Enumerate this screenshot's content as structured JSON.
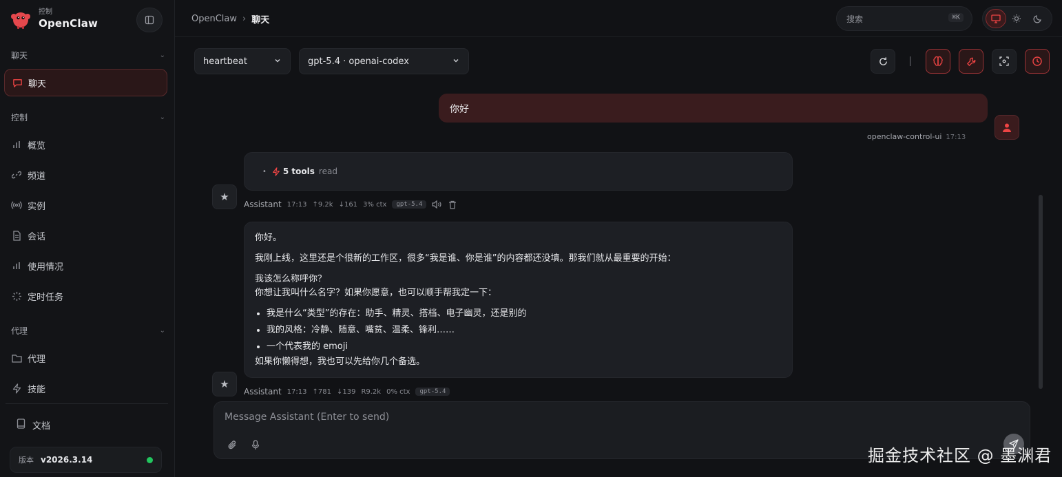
{
  "brand": {
    "subtitle": "控制",
    "name": "OpenClaw"
  },
  "sidebar": {
    "sections": [
      {
        "label": "聊天",
        "items": [
          {
            "label": "聊天",
            "icon": "message-icon",
            "active": true
          }
        ]
      },
      {
        "label": "控制",
        "items": [
          {
            "label": "概览",
            "icon": "bar-chart-icon"
          },
          {
            "label": "频道",
            "icon": "link-icon"
          },
          {
            "label": "实例",
            "icon": "broadcast-icon"
          },
          {
            "label": "会话",
            "icon": "file-icon"
          },
          {
            "label": "使用情况",
            "icon": "bar-chart-icon"
          },
          {
            "label": "定时任务",
            "icon": "loader-icon"
          }
        ]
      },
      {
        "label": "代理",
        "items": [
          {
            "label": "代理",
            "icon": "folder-icon"
          },
          {
            "label": "技能",
            "icon": "zap-icon"
          }
        ]
      }
    ],
    "docs_label": "文档",
    "version_label": "版本",
    "version_value": "v2026.3.14",
    "status_color": "#22c55e"
  },
  "header": {
    "breadcrumb": [
      "OpenClaw",
      "聊天"
    ],
    "search_placeholder": "搜索",
    "search_shortcut": "⌘K"
  },
  "chat": {
    "session_select": "heartbeat",
    "model_select": "gpt-5.4 · openai-codex",
    "messages": [
      {
        "role": "user",
        "text": "你好",
        "sender": "openclaw-control-ui",
        "time": "17:13"
      },
      {
        "role": "assistant",
        "tools_count": "5 tools",
        "tools_desc": "read",
        "meta": {
          "who": "Assistant",
          "time": "17:13",
          "up": "↑9.2k",
          "down": "↓161",
          "ctx": "3% ctx",
          "model": "gpt-5.4"
        }
      },
      {
        "role": "assistant",
        "paragraphs": [
          "你好。",
          "我刚上线，这里还是个很新的工作区，很多“我是谁、你是谁”的内容都还没填。那我们就从最重要的开始：",
          "我该怎么称呼你？",
          "你想让我叫什么名字？如果你愿意，也可以顺手帮我定一下："
        ],
        "bullets": [
          "我是什么“类型”的存在：助手、精灵、搭档、电子幽灵，还是别的",
          "我的风格：冷静、随意、嘴贫、温柔、锋利……",
          "一个代表我的 emoji"
        ],
        "closing": "如果你懒得想，我也可以先给你几个备选。",
        "meta": {
          "who": "Assistant",
          "time": "17:13",
          "up": "↑781",
          "down": "↓139",
          "cache": "R9.2k",
          "ctx": "0% ctx",
          "model": "gpt-5.4"
        }
      }
    ],
    "composer_placeholder": "Message Assistant (Enter to send)"
  },
  "watermark": "掘金技术社区 @ 墨渊君",
  "colors": {
    "accent": "#ef4444",
    "background": "#111215"
  }
}
